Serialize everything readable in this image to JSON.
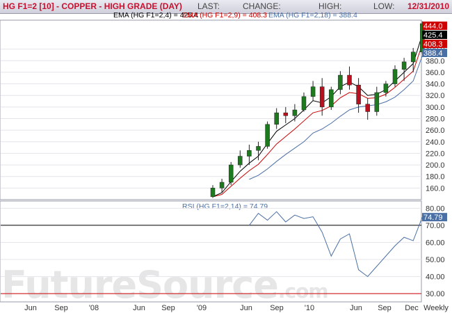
{
  "header": {
    "title": "HG F1=2 [10] - COPPER - HIGH GRADE (DAY)",
    "last_label": "LAST:",
    "change_label": "CHANGE:",
    "high_label": "HIGH:",
    "low_label": "LOW:",
    "date": "12/31/2010"
  },
  "legend": {
    "ema1": "EMA (HG F1=2,4) = 425.4",
    "ema2": "EMA (HG F1=2,9) = 408.3",
    "ema3": "EMA (HG F1=2,18) = 388.4",
    "rsi": "RSI (HG F1=2,14) = 74.79"
  },
  "colors": {
    "ema1": "#000000",
    "ema2": "#cc0000",
    "ema3": "#4a6fa5",
    "rsi": "#4a6fa5",
    "up": "#1e7a1e",
    "down": "#b8101e"
  },
  "watermark": {
    "main": "FutureSource",
    "suffix": ".com"
  },
  "chart_data": [
    {
      "type": "candlestick",
      "ylim": [
        140,
        450
      ],
      "y_ticks": [
        160,
        180,
        200,
        220,
        240,
        260,
        280,
        300,
        320,
        340,
        360,
        380,
        400
      ],
      "x_ticks": [
        "Jun",
        "Sep",
        "'08",
        "Jun",
        "Sep",
        "'09",
        "Jun",
        "Sep",
        "'10",
        "Jun",
        "Sep",
        "Dec",
        "Weekly"
      ],
      "last_value_labels": [
        {
          "value": "444.0",
          "color": "#cc0000"
        },
        {
          "value": "425.4",
          "color": "#000000"
        },
        {
          "value": "408.3",
          "color": "#cc0000"
        },
        {
          "value": "388.4",
          "color": "#4a6fa5"
        }
      ],
      "x": [
        "2009-01",
        "2009-02",
        "2009-03",
        "2009-04",
        "2009-05",
        "2009-06",
        "2009-07",
        "2009-08",
        "2009-09",
        "2009-10",
        "2009-11",
        "2009-12",
        "2010-01",
        "2010-02",
        "2010-03",
        "2010-04",
        "2010-05",
        "2010-06",
        "2010-07",
        "2010-08",
        "2010-09",
        "2010-10",
        "2010-11",
        "2010-12"
      ],
      "ohlc": [
        [
          145,
          165,
          143,
          160
        ],
        [
          160,
          176,
          152,
          170
        ],
        [
          170,
          205,
          165,
          200
        ],
        [
          200,
          225,
          195,
          215
        ],
        [
          215,
          235,
          200,
          225
        ],
        [
          225,
          240,
          208,
          232
        ],
        [
          232,
          275,
          228,
          270
        ],
        [
          270,
          298,
          262,
          290
        ],
        [
          290,
          300,
          272,
          285
        ],
        [
          285,
          305,
          275,
          295
        ],
        [
          295,
          325,
          292,
          318
        ],
        [
          318,
          345,
          310,
          335
        ],
        [
          335,
          350,
          285,
          300
        ],
        [
          300,
          335,
          295,
          330
        ],
        [
          330,
          362,
          322,
          355
        ],
        [
          355,
          370,
          330,
          338
        ],
        [
          338,
          350,
          290,
          305
        ],
        [
          305,
          315,
          278,
          292
        ],
        [
          292,
          335,
          285,
          325
        ],
        [
          325,
          345,
          318,
          340
        ],
        [
          340,
          372,
          335,
          365
        ],
        [
          365,
          385,
          345,
          378
        ],
        [
          378,
          402,
          360,
          395
        ],
        [
          395,
          448,
          392,
          444
        ]
      ],
      "ema_4": [
        145,
        152,
        171,
        189,
        203,
        215,
        237,
        258,
        269,
        280,
        295,
        311,
        307,
        318,
        335,
        343,
        335,
        320,
        322,
        330,
        345,
        360,
        375,
        425.4
      ],
      "ema_9": [
        145,
        149,
        163,
        177,
        190,
        201,
        218,
        236,
        249,
        262,
        276,
        290,
        294,
        302,
        316,
        325,
        323,
        315,
        316,
        322,
        334,
        348,
        362,
        408.3
      ],
      "ema_18": [
        null,
        null,
        null,
        null,
        175,
        182,
        193,
        206,
        218,
        229,
        240,
        255,
        262,
        272,
        284,
        295,
        300,
        302,
        304,
        309,
        317,
        330,
        345,
        388.4
      ]
    },
    {
      "type": "line",
      "title": "RSI (HG F1=2,14) = 74.79",
      "ylim": [
        26,
        83
      ],
      "y_ticks": [
        30,
        40,
        50,
        60,
        70,
        80
      ],
      "reference_lines": [
        70,
        30
      ],
      "x": [
        "2009-05",
        "2009-06",
        "2009-07",
        "2009-08",
        "2009-09",
        "2009-10",
        "2009-11",
        "2009-12",
        "2010-01",
        "2010-02",
        "2010-03",
        "2010-04",
        "2010-05",
        "2010-06",
        "2010-07",
        "2010-08",
        "2010-09",
        "2010-10",
        "2010-11",
        "2010-12"
      ],
      "values": [
        70,
        77,
        73,
        78,
        72,
        76,
        74,
        75,
        66,
        52,
        62,
        65,
        44,
        40,
        46,
        52,
        58,
        63,
        61,
        74.79
      ]
    }
  ]
}
